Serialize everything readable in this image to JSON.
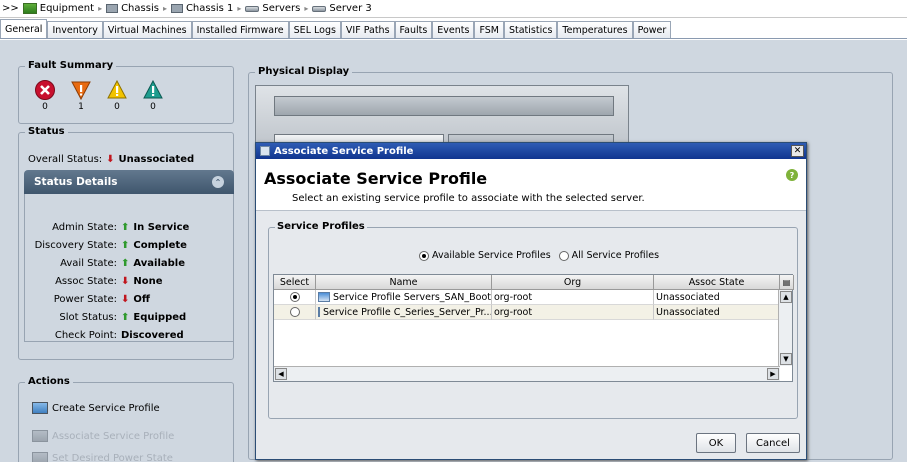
{
  "breadcrumb": {
    "prefix": ">>",
    "items": [
      "Equipment",
      "Chassis",
      "Chassis 1",
      "Servers",
      "Server 3"
    ]
  },
  "tabs": [
    "General",
    "Inventory",
    "Virtual Machines",
    "Installed Firmware",
    "SEL Logs",
    "VIF Paths",
    "Faults",
    "Events",
    "FSM",
    "Statistics",
    "Temperatures",
    "Power"
  ],
  "active_tab": "General",
  "fault_summary": {
    "title": "Fault Summary",
    "counts": [
      {
        "severity": "critical",
        "icon": "critical-fault-icon",
        "count": "0",
        "color": "#c8102e"
      },
      {
        "severity": "major",
        "icon": "major-fault-icon",
        "count": "1",
        "color": "#e86a10"
      },
      {
        "severity": "minor",
        "icon": "minor-fault-icon",
        "count": "0",
        "color": "#f2c300"
      },
      {
        "severity": "warning",
        "icon": "warning-fault-icon",
        "count": "0",
        "color": "#1d9c8e"
      }
    ]
  },
  "status": {
    "title": "Status",
    "overall_label": "Overall Status:",
    "overall_value": "Unassociated",
    "details_title": "Status Details",
    "rows": [
      {
        "label": "Admin State:",
        "value": "In Service",
        "dir": "up"
      },
      {
        "label": "Discovery State:",
        "value": "Complete",
        "dir": "up"
      },
      {
        "label": "Avail State:",
        "value": "Available",
        "dir": "up"
      },
      {
        "label": "Assoc State:",
        "value": "None",
        "dir": "down"
      },
      {
        "label": "Power State:",
        "value": "Off",
        "dir": "down"
      },
      {
        "label": "Slot Status:",
        "value": "Equipped",
        "dir": "up"
      },
      {
        "label": "Check Point:",
        "value": "Discovered",
        "dir": "none"
      }
    ]
  },
  "actions": {
    "title": "Actions",
    "items": [
      {
        "label": "Create Service Profile",
        "enabled": true
      },
      {
        "label": "Associate Service Profile",
        "enabled": false
      },
      {
        "label": "Set Desired Power State",
        "enabled": false
      }
    ]
  },
  "physical_display": {
    "title": "Physical Display"
  },
  "dialog": {
    "window_title": "Associate Service Profile",
    "heading": "Associate Service Profile",
    "subheading": "Select an existing service profile to associate with the selected server.",
    "group_title": "Service Profiles",
    "radio_available": "Available Service Profiles",
    "radio_all": "All Service Profiles",
    "selected_radio": "available",
    "columns": [
      "Select",
      "Name",
      "Org",
      "Assoc State"
    ],
    "rows": [
      {
        "selected": true,
        "name": "Service Profile Servers_SAN_Boot",
        "org": "org-root",
        "assoc_state": "Unassociated"
      },
      {
        "selected": false,
        "name": "Service Profile C_Series_Server_Pr...",
        "org": "org-root",
        "assoc_state": "Unassociated"
      }
    ],
    "ok_label": "OK",
    "cancel_label": "Cancel"
  }
}
